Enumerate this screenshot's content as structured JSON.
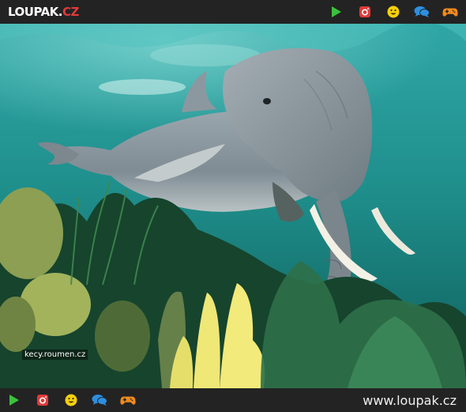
{
  "header": {
    "logo_main": "LOUPAK.",
    "logo_tld": "CZ",
    "icons": [
      "play-icon",
      "instagram-icon",
      "smiley-icon",
      "chat-icon",
      "gamepad-icon"
    ]
  },
  "image": {
    "watermark": "kecy.roumen.cz"
  },
  "footer": {
    "icons": [
      "play-icon",
      "instagram-icon",
      "smiley-icon",
      "chat-icon",
      "gamepad-icon"
    ],
    "site_url": "www.loupak.cz"
  },
  "colors": {
    "bar_background": "#232323",
    "play": "#3cc13c",
    "instagram": "#e23a3a",
    "smiley": "#f5d10b",
    "chat": "#2d8fe0",
    "gamepad": "#f08a1c",
    "water": "#1f8f8c"
  }
}
